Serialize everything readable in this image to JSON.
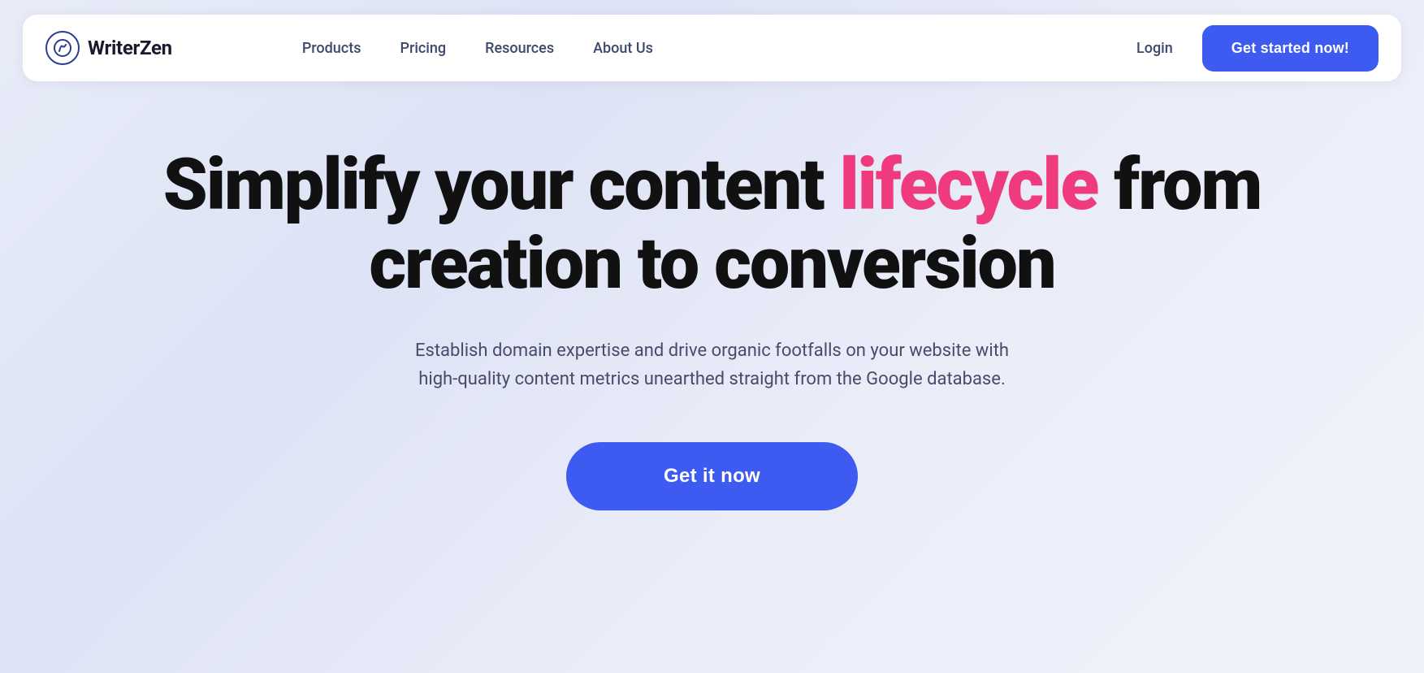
{
  "brand": {
    "logo_text": "WriterZen",
    "logo_icon_char": "✍"
  },
  "navbar": {
    "links": [
      {
        "label": "Products",
        "id": "products"
      },
      {
        "label": "Pricing",
        "id": "pricing"
      },
      {
        "label": "Resources",
        "id": "resources"
      },
      {
        "label": "About Us",
        "id": "about-us"
      }
    ],
    "login_label": "Login",
    "cta_label": "Get started now!"
  },
  "hero": {
    "headline_part1": "Simplify your content ",
    "headline_highlight": "lifecycle",
    "headline_part2": " from",
    "headline_line2": "creation to conversion",
    "subtext": "Establish domain expertise and drive organic footfalls on your website with high-quality content metrics unearthed straight from the Google database.",
    "cta_label": "Get it now"
  }
}
